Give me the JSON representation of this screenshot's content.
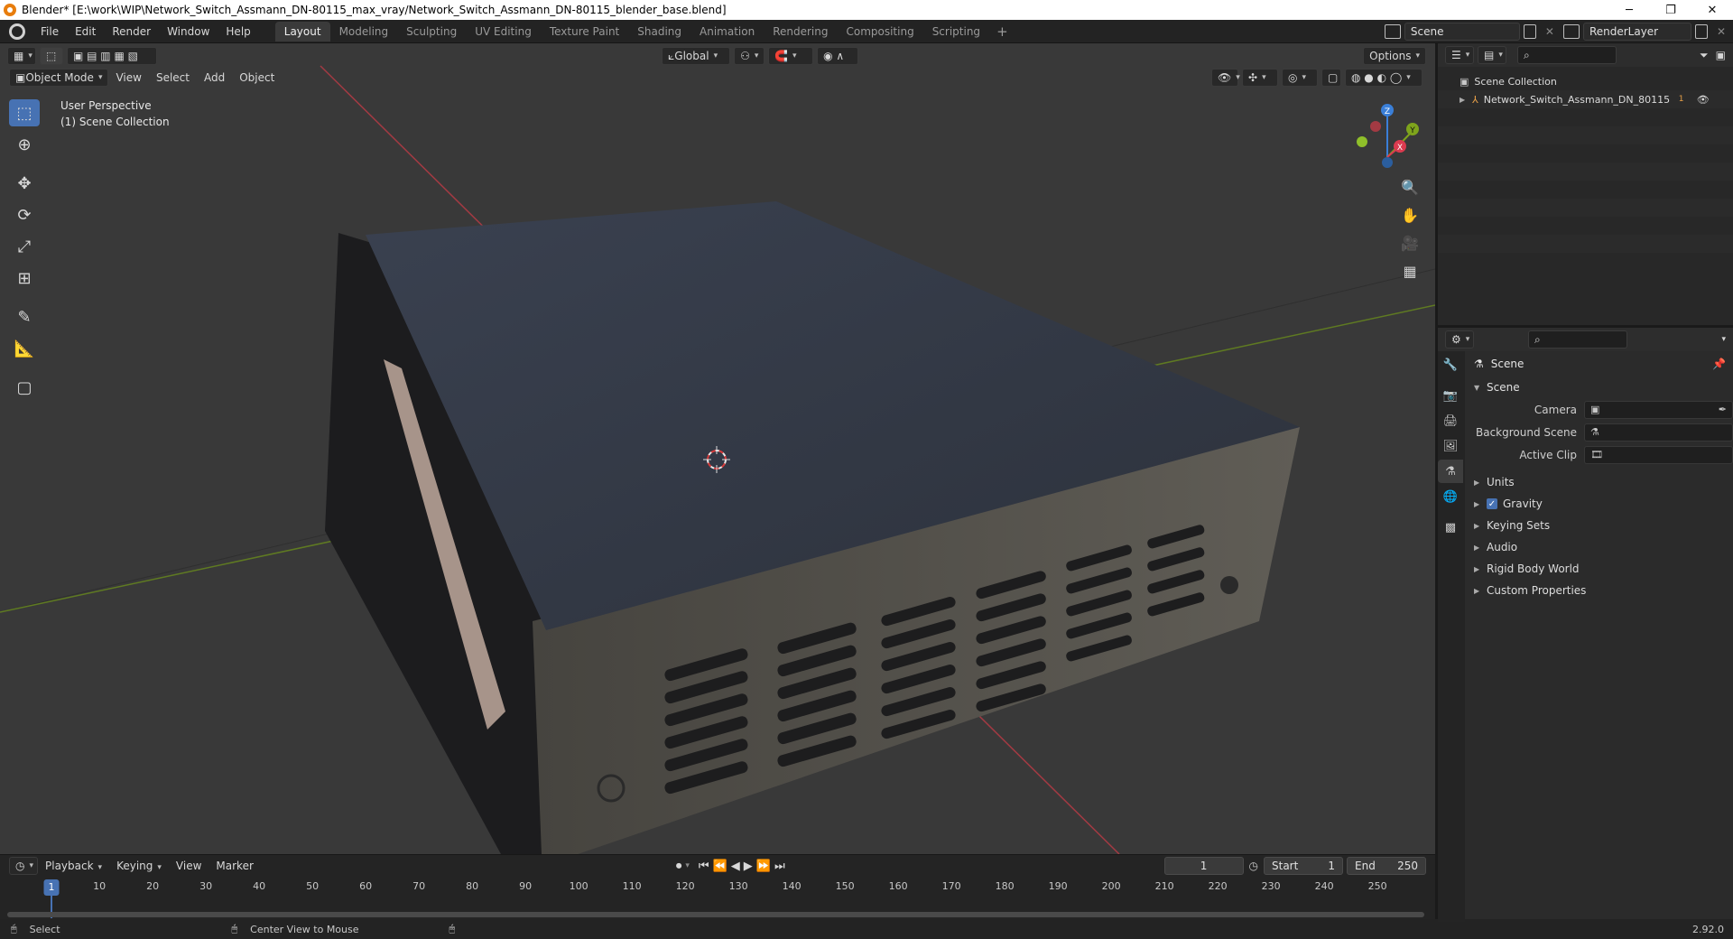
{
  "window": {
    "title": "Blender* [E:\\work\\WIP\\Network_Switch_Assmann_DN-80115_max_vray/Network_Switch_Assmann_DN-80115_blender_base.blend]",
    "min": "─",
    "restore": "❐",
    "close": "✕"
  },
  "menu": [
    "File",
    "Edit",
    "Render",
    "Window",
    "Help"
  ],
  "workspaces": [
    "Layout",
    "Modeling",
    "Sculpting",
    "UV Editing",
    "Texture Paint",
    "Shading",
    "Animation",
    "Rendering",
    "Compositing",
    "Scripting"
  ],
  "workspace_add": "+",
  "scene_field": "Scene",
  "renderlayer_field": "RenderLayer",
  "viewport": {
    "transform_orientation": "Global",
    "options_label": "Options",
    "mode": "Object Mode",
    "menus": [
      "View",
      "Select",
      "Add",
      "Object"
    ],
    "perspective_label": "User Perspective",
    "collection_label": "(1) Scene Collection",
    "gizmo": {
      "x": "X",
      "y": "Y",
      "z": "Z"
    }
  },
  "timeline": {
    "menus": [
      "Playback",
      "Keying",
      "View",
      "Marker"
    ],
    "current_frame": "1",
    "start_label": "Start",
    "start_value": "1",
    "end_label": "End",
    "end_value": "250",
    "ticks": [
      "10",
      "20",
      "30",
      "40",
      "50",
      "60",
      "70",
      "80",
      "90",
      "100",
      "110",
      "120",
      "130",
      "140",
      "150",
      "160",
      "170",
      "180",
      "190",
      "200",
      "210",
      "220",
      "230",
      "240",
      "250"
    ],
    "ruler_current": "1"
  },
  "statusbar": {
    "left": "Select",
    "middle": "Center View to Mouse",
    "version": "2.92.0"
  },
  "outliner": {
    "root": "Scene Collection",
    "items": [
      {
        "name": "Network_Switch_Assmann_DN_80115",
        "badge": "1"
      }
    ]
  },
  "properties": {
    "context_title": "Scene",
    "section": "Scene",
    "fields": [
      {
        "label": "Camera"
      },
      {
        "label": "Background Scene"
      },
      {
        "label": "Active Clip"
      }
    ],
    "subsections": [
      "Units",
      "Gravity",
      "Keying Sets",
      "Audio",
      "Rigid Body World",
      "Custom Properties"
    ]
  },
  "colors": {
    "accent": "#4772b3",
    "axis_x": "#db3a4f",
    "axis_y": "#7ea41c",
    "axis_z": "#3a7fd8"
  }
}
